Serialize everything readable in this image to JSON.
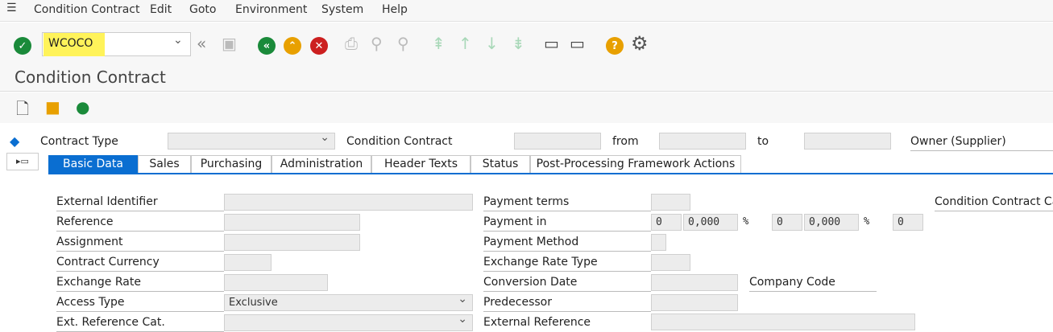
{
  "menubar": {
    "items": [
      "Condition Contract",
      "Edit",
      "Goto",
      "Environment",
      "System",
      "Help"
    ]
  },
  "toolbar": {
    "command_value": "WCOCO"
  },
  "title": "Condition Contract",
  "header": {
    "contract_type_label": "Contract Type",
    "contract_type_value": "",
    "condition_contract_label": "Condition Contract",
    "from_label": "from",
    "to_label": "to",
    "owner_label": "Owner (Supplier)"
  },
  "tabs": [
    {
      "label": "Basic Data",
      "selected": true
    },
    {
      "label": "Sales"
    },
    {
      "label": "Purchasing"
    },
    {
      "label": "Administration"
    },
    {
      "label": "Header Texts"
    },
    {
      "label": "Status"
    },
    {
      "label": "Post-Processing Framework Actions"
    }
  ],
  "left_fields": [
    {
      "label": "External Identifier",
      "value": ""
    },
    {
      "label": "Reference",
      "value": ""
    },
    {
      "label": "Assignment",
      "value": ""
    },
    {
      "label": "Contract Currency",
      "value": ""
    },
    {
      "label": "Exchange Rate",
      "value": ""
    },
    {
      "label": "Access Type",
      "value": "Exclusive"
    },
    {
      "label": "Ext. Reference Cat.",
      "value": ""
    }
  ],
  "right_fields": {
    "payment_terms": "Payment terms",
    "payment_in": {
      "label": "Payment in",
      "days1": "0",
      "pct1": "0,000",
      "days2": "0",
      "pct2": "0,000",
      "days3": "0",
      "pct_sign": "%"
    },
    "payment_method": "Payment Method",
    "exchange_rate_type": "Exchange Rate Type",
    "conversion_date": "Conversion Date",
    "company_code": "Company Code",
    "predecessor": "Predecessor",
    "external_reference": "External Reference",
    "category": "Condition Contract Cate"
  },
  "colors": {
    "accent": "#0a6ed1",
    "highlight": "#fff35a"
  }
}
